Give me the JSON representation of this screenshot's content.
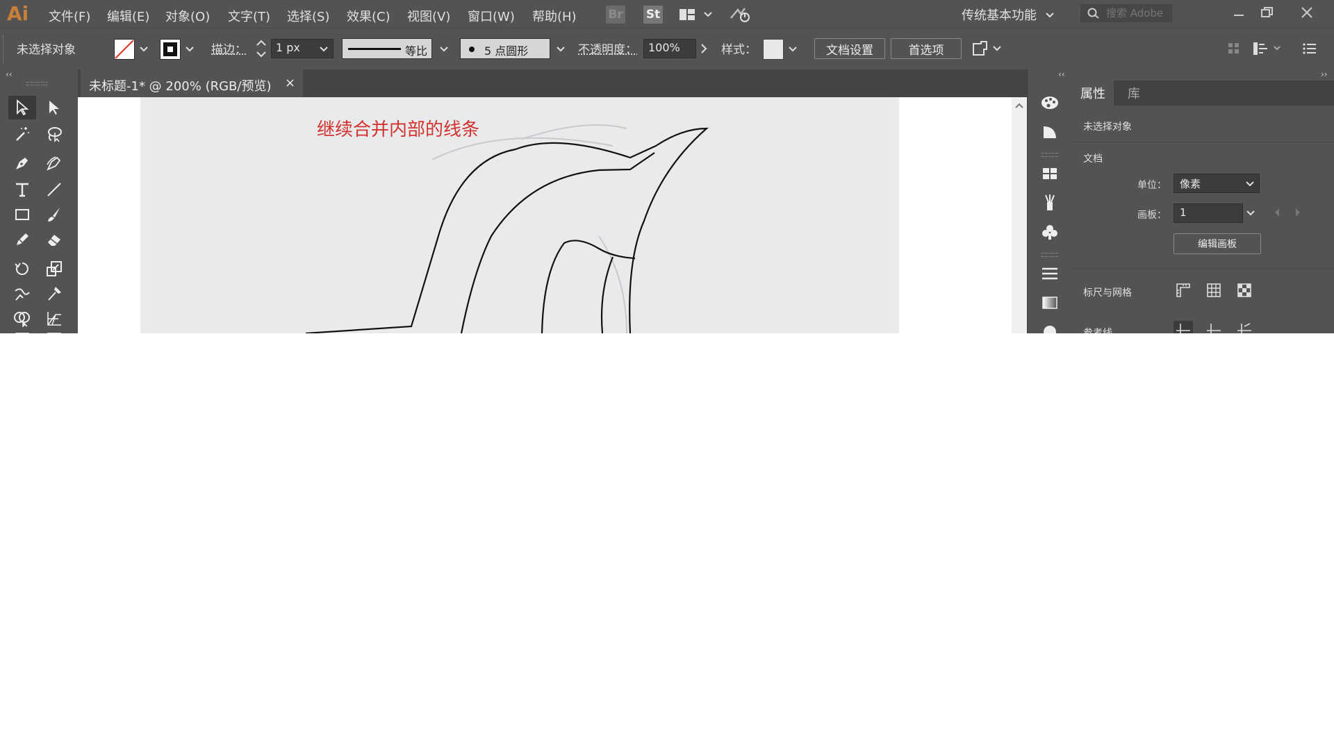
{
  "app": {
    "logo": "Ai"
  },
  "menu": [
    "文件(F)",
    "编辑(E)",
    "对象(O)",
    "文字(T)",
    "选择(S)",
    "效果(C)",
    "视图(V)",
    "窗口(W)",
    "帮助(H)"
  ],
  "menubar_icons": {
    "bridge": "Br",
    "stock": "St"
  },
  "workspace": "传统基本功能",
  "search": {
    "placeholder": "搜索 Adobe"
  },
  "control": {
    "selection": "未选择对象",
    "stroke_label": "描边：",
    "stroke_weight": "1 px",
    "profile": "等比",
    "brush": "5 点圆形",
    "opacity_label": "不透明度：",
    "opacity": "100%",
    "style_label": "样式：",
    "doc_setup": "文档设置",
    "prefs": "首选项"
  },
  "document": {
    "tab_title": "未标题-1* @ 200% (RGB/预览)",
    "close": "×",
    "annotation": "继续合并内部的线条"
  },
  "properties": {
    "tabs": [
      "属性",
      "库"
    ],
    "no_selection": "未选择对象",
    "doc_section": "文档",
    "units_label": "单位：",
    "units_value": "像素",
    "artboard_label": "画板：",
    "artboard_value": "1",
    "edit_artboards": "编辑画板",
    "rulers_section": "标尺与网格",
    "guides_section": "参考线"
  },
  "colors": {
    "ui_bg": "#535353",
    "accent_red": "#d4322e",
    "logo": "#c77f3a"
  },
  "icons": [
    "selection-tool-icon",
    "direct-selection-tool-icon",
    "magic-wand-icon",
    "lasso-icon",
    "pen-icon",
    "curvature-pen-icon",
    "type-tool-icon",
    "line-tool-icon",
    "rectangle-tool-icon",
    "paintbrush-icon",
    "pencil-icon",
    "eraser-icon",
    "rotate-icon",
    "scale-icon",
    "warp-icon",
    "puppet-warp-icon",
    "shape-builder-icon",
    "perspective-grid-icon"
  ]
}
